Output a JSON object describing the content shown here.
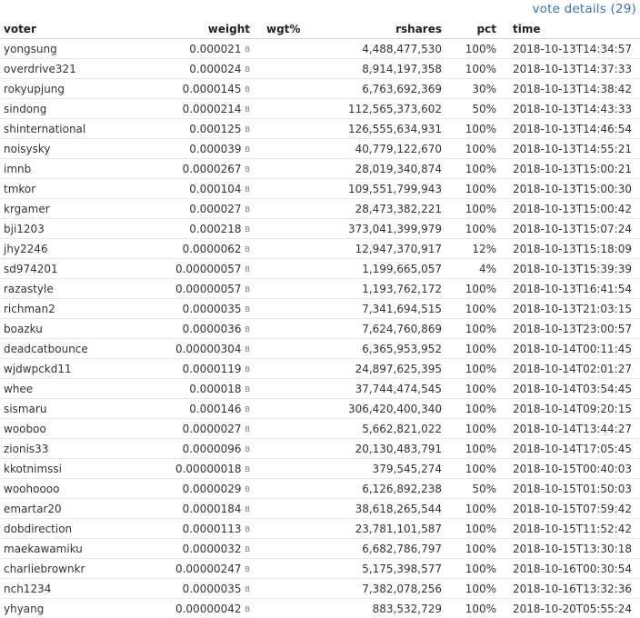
{
  "header": {
    "vote_details_link": "vote details (29)"
  },
  "table": {
    "columns": {
      "voter": "voter",
      "weight": "weight",
      "wgt": "wgt%",
      "rshares": "rshares",
      "pct": "pct",
      "time": "time"
    },
    "weight_unit": "B",
    "rows": [
      {
        "voter": "yongsung",
        "weight": "0.000021",
        "rshares": "4,488,477,530",
        "pct": "100%",
        "time": "2018-10-13T14:34:57"
      },
      {
        "voter": "overdrive321",
        "weight": "0.000024",
        "rshares": "8,914,197,358",
        "pct": "100%",
        "time": "2018-10-13T14:37:33"
      },
      {
        "voter": "rokyupjung",
        "weight": "0.0000145",
        "rshares": "6,763,692,369",
        "pct": "30%",
        "time": "2018-10-13T14:38:42"
      },
      {
        "voter": "sindong",
        "weight": "0.0000214",
        "rshares": "112,565,373,602",
        "pct": "50%",
        "time": "2018-10-13T14:43:33"
      },
      {
        "voter": "shinternational",
        "weight": "0.000125",
        "rshares": "126,555,634,931",
        "pct": "100%",
        "time": "2018-10-13T14:46:54"
      },
      {
        "voter": "noisysky",
        "weight": "0.000039",
        "rshares": "40,779,122,670",
        "pct": "100%",
        "time": "2018-10-13T14:55:21"
      },
      {
        "voter": "imnb",
        "weight": "0.0000267",
        "rshares": "28,019,340,874",
        "pct": "100%",
        "time": "2018-10-13T15:00:21"
      },
      {
        "voter": "tmkor",
        "weight": "0.000104",
        "rshares": "109,551,799,943",
        "pct": "100%",
        "time": "2018-10-13T15:00:30"
      },
      {
        "voter": "krgamer",
        "weight": "0.000027",
        "rshares": "28,473,382,221",
        "pct": "100%",
        "time": "2018-10-13T15:00:42"
      },
      {
        "voter": "bji1203",
        "weight": "0.000218",
        "rshares": "373,041,399,979",
        "pct": "100%",
        "time": "2018-10-13T15:07:24"
      },
      {
        "voter": "jhy2246",
        "weight": "0.0000062",
        "rshares": "12,947,370,917",
        "pct": "12%",
        "time": "2018-10-13T15:18:09"
      },
      {
        "voter": "sd974201",
        "weight": "0.00000057",
        "rshares": "1,199,665,057",
        "pct": "4%",
        "time": "2018-10-13T15:39:39"
      },
      {
        "voter": "razastyle",
        "weight": "0.00000057",
        "rshares": "1,193,762,172",
        "pct": "100%",
        "time": "2018-10-13T16:41:54"
      },
      {
        "voter": "richman2",
        "weight": "0.0000035",
        "rshares": "7,341,694,515",
        "pct": "100%",
        "time": "2018-10-13T21:03:15"
      },
      {
        "voter": "boazku",
        "weight": "0.0000036",
        "rshares": "7,624,760,869",
        "pct": "100%",
        "time": "2018-10-13T23:00:57"
      },
      {
        "voter": "deadcatbounce",
        "weight": "0.00000304",
        "rshares": "6,365,953,952",
        "pct": "100%",
        "time": "2018-10-14T00:11:45"
      },
      {
        "voter": "wjdwpckd11",
        "weight": "0.0000119",
        "rshares": "24,897,625,395",
        "pct": "100%",
        "time": "2018-10-14T02:01:27"
      },
      {
        "voter": "whee",
        "weight": "0.000018",
        "rshares": "37,744,474,545",
        "pct": "100%",
        "time": "2018-10-14T03:54:45"
      },
      {
        "voter": "sismaru",
        "weight": "0.000146",
        "rshares": "306,420,400,340",
        "pct": "100%",
        "time": "2018-10-14T09:20:15"
      },
      {
        "voter": "wooboo",
        "weight": "0.0000027",
        "rshares": "5,662,821,022",
        "pct": "100%",
        "time": "2018-10-14T13:44:27"
      },
      {
        "voter": "zionis33",
        "weight": "0.0000096",
        "rshares": "20,130,483,791",
        "pct": "100%",
        "time": "2018-10-14T17:05:45"
      },
      {
        "voter": "kkotnimssi",
        "weight": "0.00000018",
        "rshares": "379,545,274",
        "pct": "100%",
        "time": "2018-10-15T00:40:03"
      },
      {
        "voter": "woohoooo",
        "weight": "0.0000029",
        "rshares": "6,126,892,238",
        "pct": "50%",
        "time": "2018-10-15T01:50:03"
      },
      {
        "voter": "emartar20",
        "weight": "0.0000184",
        "rshares": "38,618,265,544",
        "pct": "100%",
        "time": "2018-10-15T07:59:42"
      },
      {
        "voter": "dobdirection",
        "weight": "0.0000113",
        "rshares": "23,781,101,587",
        "pct": "100%",
        "time": "2018-10-15T11:52:42"
      },
      {
        "voter": "maekawamiku",
        "weight": "0.0000032",
        "rshares": "6,682,786,797",
        "pct": "100%",
        "time": "2018-10-15T13:30:18"
      },
      {
        "voter": "charliebrownkr",
        "weight": "0.00000247",
        "rshares": "5,175,398,577",
        "pct": "100%",
        "time": "2018-10-16T00:30:54"
      },
      {
        "voter": "nch1234",
        "weight": "0.0000035",
        "rshares": "7,382,078,256",
        "pct": "100%",
        "time": "2018-10-16T13:32:36"
      },
      {
        "voter": "yhyang",
        "weight": "0.00000042",
        "rshares": "883,532,729",
        "pct": "100%",
        "time": "2018-10-20T05:55:24"
      }
    ]
  }
}
